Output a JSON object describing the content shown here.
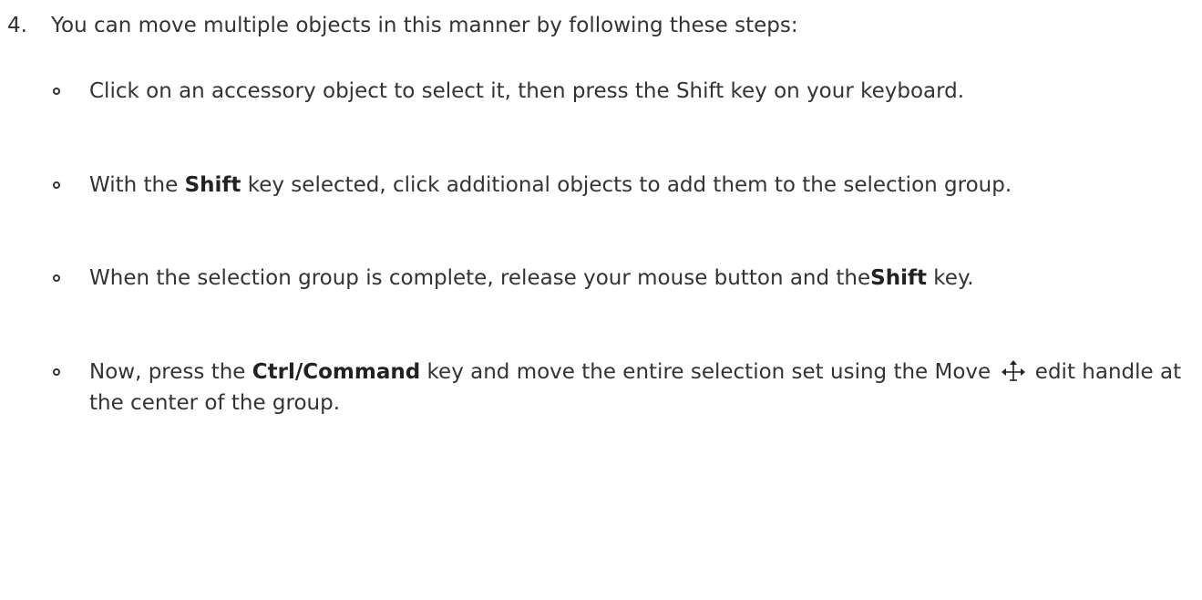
{
  "step": {
    "number": "4.",
    "text": "You can move multiple objects in this manner by following these steps:"
  },
  "substeps": [
    {
      "text": "Click on an accessory object to select it, then press the Shift key on your keyboard."
    },
    {
      "before": "With the ",
      "bold": "Shift",
      "after": " key selected, click additional objects to add them to the selection group."
    },
    {
      "before": "When the selection group is complete, release your mouse button and the",
      "bold": "Shift",
      "after": " key."
    },
    {
      "before": "Now, press the ",
      "bold": "Ctrl/Command",
      "middle": " key and move the entire selection set using the Move ",
      "icon": "move-arrows-icon",
      "after": " edit handle at the center of the group."
    }
  ]
}
